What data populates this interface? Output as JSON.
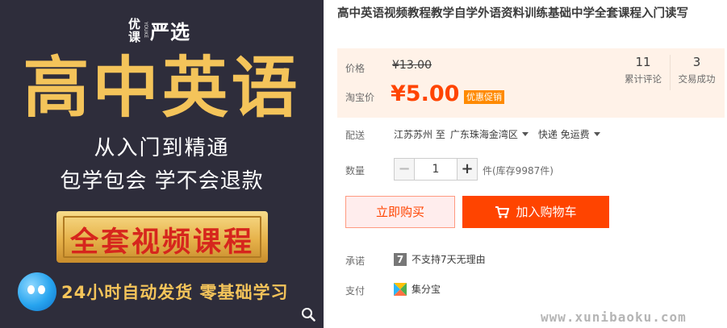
{
  "image": {
    "brand_you": "优",
    "brand_ke": "课",
    "brand_youke": "YOUKE",
    "brand_yanxuan": "严选",
    "hero_title": "高中英语",
    "subtitle_1": "从入门到精通",
    "subtitle_2": "包学包会 学不会退款",
    "banner": "全套视频课程",
    "bottom_text": "24小时自动发货 零基础学习"
  },
  "product": {
    "title": "高中英语视频教程教学自学外语资料训练基础中学全套课程入门读写"
  },
  "price": {
    "original_label": "价格",
    "original_price": "¥13.00",
    "taobao_label": "淘宝价",
    "sale_price": "¥5.00",
    "promo_badge": "优惠促销"
  },
  "stats": {
    "reviews_count": "11",
    "reviews_label": "累计评论",
    "deals_count": "3",
    "deals_label": "交易成功"
  },
  "shipping": {
    "label": "配送",
    "from": "江苏苏州 至",
    "to": "广东珠海金湾区",
    "method": "快递 免运费"
  },
  "quantity": {
    "label": "数量",
    "minus": "−",
    "value": "1",
    "plus": "+",
    "stock": "件(库存9987件)"
  },
  "actions": {
    "buy_now": "立即购买",
    "add_to_cart": "加入购物车"
  },
  "promise": {
    "label": "承诺",
    "icon_text": "7",
    "text": "不支持7天无理由"
  },
  "payment": {
    "label": "支付",
    "text": "集分宝"
  },
  "watermark": "www.xunibaoku.com",
  "colors": {
    "accent": "#ff4400",
    "price_panel_bg": "#fff2e8",
    "image_bg": "#2e2d3b",
    "gold": "#f4c45a"
  },
  "icons": [
    "zoom-icon",
    "cart-icon",
    "caret-down-icon",
    "seven-day-icon",
    "jifenbao-icon",
    "mascot-icon"
  ]
}
